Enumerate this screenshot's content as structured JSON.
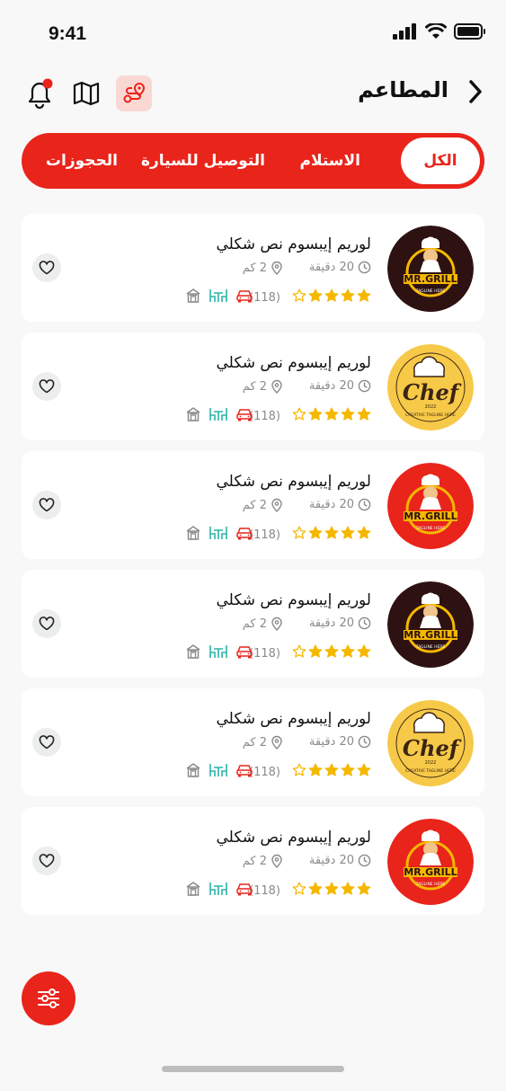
{
  "status": {
    "time": "9:41"
  },
  "header": {
    "title": "المطاعم"
  },
  "tabs": [
    {
      "label": "الكل",
      "active": true
    },
    {
      "label": "الاستلام"
    },
    {
      "label": "التوصيل للسيارة"
    },
    {
      "label": "الحجوزات"
    }
  ],
  "restaurants": [
    {
      "name": "لوريم إيبسوم نص شكلي",
      "time": "20 دقيقة",
      "distance": "2 كم",
      "rating": 4,
      "reviews": "(118)",
      "logo": "mrgrill-dark"
    },
    {
      "name": "لوريم إيبسوم نص شكلي",
      "time": "20 دقيقة",
      "distance": "2 كم",
      "rating": 4,
      "reviews": "(118)",
      "logo": "chef-yellow"
    },
    {
      "name": "لوريم إيبسوم نص شكلي",
      "time": "20 دقيقة",
      "distance": "2 كم",
      "rating": 4,
      "reviews": "(118)",
      "logo": "mrgrill-red"
    },
    {
      "name": "لوريم إيبسوم نص شكلي",
      "time": "20 دقيقة",
      "distance": "2 كم",
      "rating": 4,
      "reviews": "(118)",
      "logo": "mrgrill-dark"
    },
    {
      "name": "لوريم إيبسوم نص شكلي",
      "time": "20 دقيقة",
      "distance": "2 كم",
      "rating": 4,
      "reviews": "(118)",
      "logo": "chef-yellow"
    },
    {
      "name": "لوريم إيبسوم نص شكلي",
      "time": "20 دقيقة",
      "distance": "2 كم",
      "rating": 4,
      "reviews": "(118)",
      "logo": "mrgrill-red"
    }
  ],
  "logos": {
    "mrgrill": {
      "brand": "MR.GRILL",
      "tagline": "TAGLINE HERE"
    },
    "chef": {
      "brand": "Chef",
      "tagline": "CREATIVE TAGLINE HERE",
      "year": "2022"
    }
  },
  "icons": [
    "back-chevron-icon",
    "route-icon",
    "map-icon",
    "bell-icon",
    "clock-icon",
    "location-pin-icon",
    "star-icon",
    "car-icon",
    "dine-in-icon",
    "pickup-store-icon",
    "heart-icon",
    "filter-sliders-icon"
  ],
  "colors": {
    "accent": "#e9241b",
    "star": "#f5b800",
    "route_bg": "#f9d8d4",
    "teal": "#2bb3a6"
  }
}
